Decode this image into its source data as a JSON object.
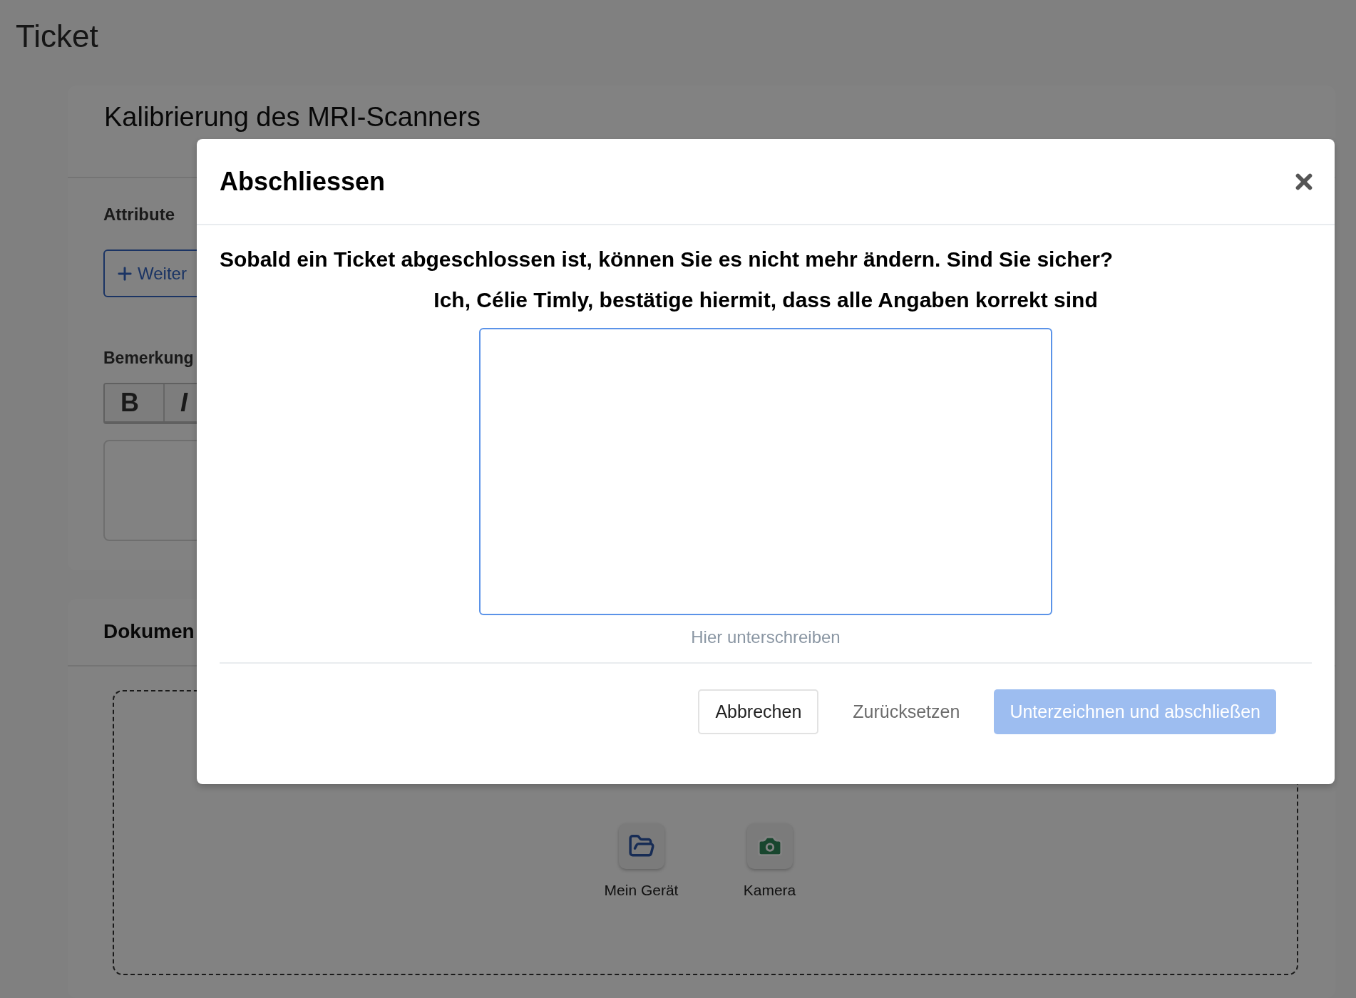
{
  "page": {
    "title": "Ticket"
  },
  "ticket_card": {
    "title": "Kalibrierung des MRI-Scanners",
    "attributes_label": "Attribute",
    "add_button": "Weiter",
    "remarks_label": "Bemerkung",
    "toolbar": [
      "B",
      "I"
    ]
  },
  "documents_card": {
    "title": "Dokumen",
    "sources": [
      {
        "kind": "folder",
        "label": "Mein Gerät"
      },
      {
        "kind": "camera",
        "label": "Kamera"
      }
    ]
  },
  "dialog": {
    "title": "Abschliessen",
    "question": "Sobald ein Ticket abgeschlossen ist, können Sie es nicht mehr ändern. Sind Sie sicher?",
    "confirmation": "Ich, Célie Timly, bestätige hiermit, dass alle Angaben korrekt sind",
    "signature_hint": "Hier unterschreiben",
    "buttons": [
      {
        "label": "Abbrechen",
        "kind": "outline",
        "disabled": false
      },
      {
        "label": "Zurücksetzen",
        "kind": "link",
        "disabled": false
      },
      {
        "label": "Unterzeichnen und abschließen",
        "kind": "primary",
        "disabled": true
      }
    ]
  }
}
